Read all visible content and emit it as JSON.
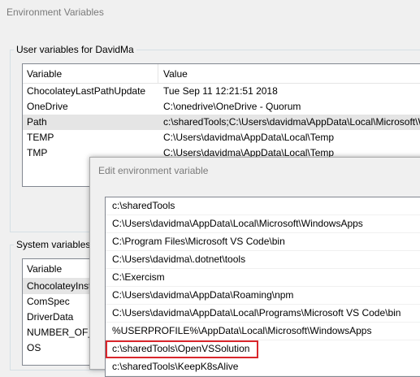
{
  "window": {
    "title": "Environment Variables"
  },
  "user_group": {
    "label": "User variables for DavidMa",
    "columns": [
      "Variable",
      "Value"
    ],
    "rows": [
      {
        "variable": "ChocolateyLastPathUpdate",
        "value": "Tue Sep 11 12:21:51 2018"
      },
      {
        "variable": "OneDrive",
        "value": "C:\\onedrive\\OneDrive - Quorum"
      },
      {
        "variable": "Path",
        "value": "c:\\sharedTools;C:\\Users\\davidma\\AppData\\Local\\Microsoft\\Win"
      },
      {
        "variable": "TEMP",
        "value": "C:\\Users\\davidma\\AppData\\Local\\Temp"
      },
      {
        "variable": "TMP",
        "value": "C:\\Users\\davidma\\AppData\\Local\\Temp"
      }
    ]
  },
  "system_group": {
    "label": "System variables",
    "columns": [
      "Variable"
    ],
    "rows": [
      {
        "variable": "ChocolateyInsta"
      },
      {
        "variable": "ComSpec"
      },
      {
        "variable": "DriverData"
      },
      {
        "variable": "NUMBER_OF_P"
      },
      {
        "variable": "OS"
      }
    ]
  },
  "dialog": {
    "title": "Edit environment variable",
    "paths": [
      "c:\\sharedTools",
      "C:\\Users\\davidma\\AppData\\Local\\Microsoft\\WindowsApps",
      "C:\\Program Files\\Microsoft VS Code\\bin",
      "C:\\Users\\davidma\\.dotnet\\tools",
      "C:\\Exercism",
      "C:\\Users\\davidma\\AppData\\Roaming\\npm",
      "C:\\Users\\davidma\\AppData\\Local\\Programs\\Microsoft VS Code\\bin",
      "%USERPROFILE%\\AppData\\Local\\Microsoft\\WindowsApps",
      "c:\\sharedTools\\OpenVSSolution",
      "c:\\sharedTools\\KeepK8sAlive"
    ],
    "highlight_color": "#d9262c"
  }
}
